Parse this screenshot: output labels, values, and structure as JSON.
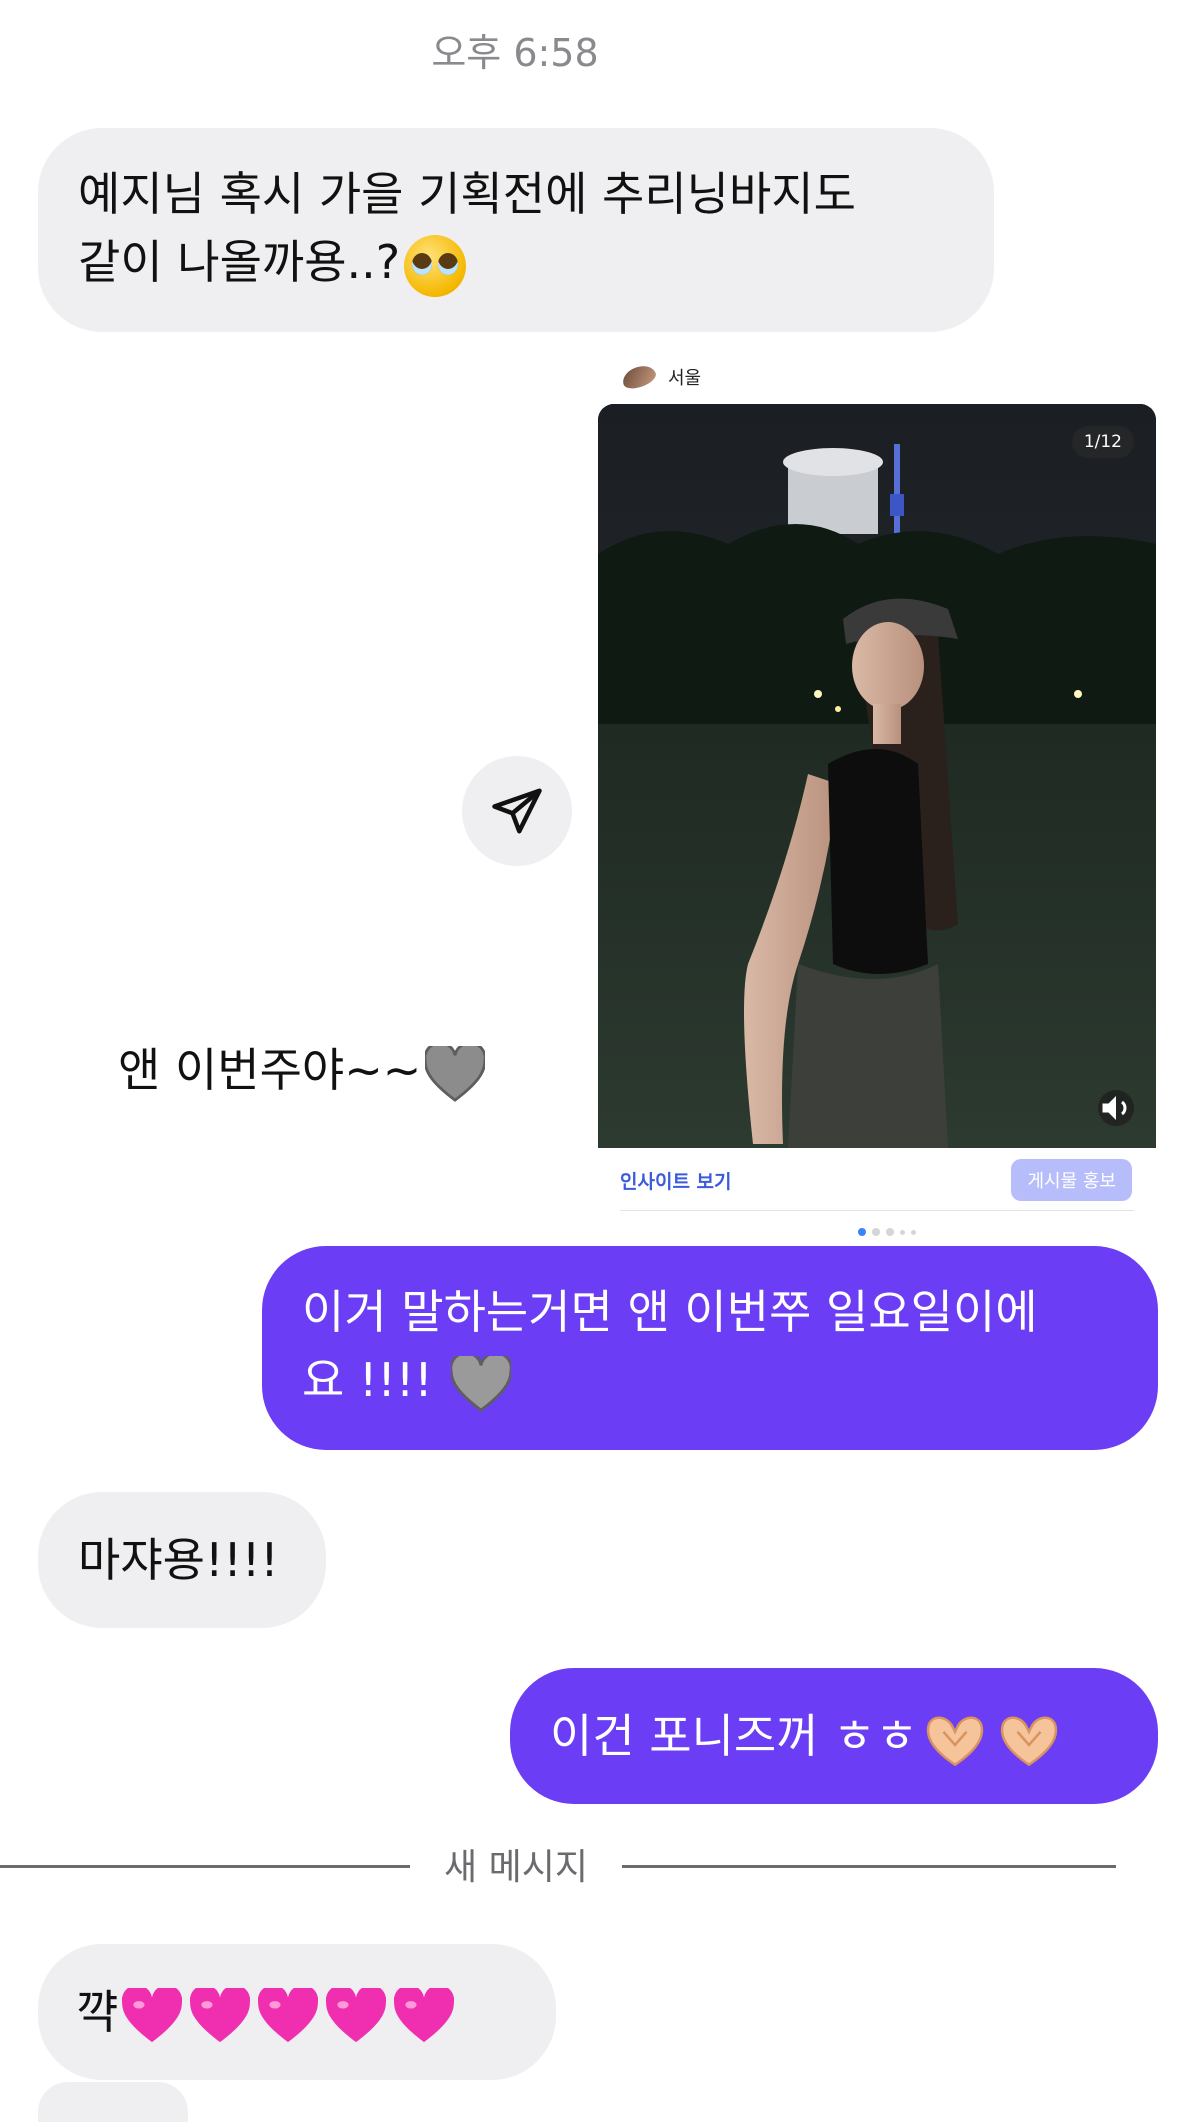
{
  "conversation": {
    "timestamp": "오후 6:58",
    "messages": [
      {
        "direction": "incoming",
        "text": "예지님 혹시 가을 기획전에 추리닝바지도\n같이 나올까용..?",
        "emoji": "pleading-face"
      },
      {
        "direction": "outgoing",
        "type": "shared_post"
      },
      {
        "direction": "outgoing",
        "text": "이거 말하는거면 앤 이번쭈 일요일이에\n요 !!!! ",
        "emoji": "grey-heart"
      },
      {
        "direction": "incoming",
        "text": "마쟈용!!!!"
      },
      {
        "direction": "outgoing",
        "text": "이건 포니즈꺼 ㅎㅎ",
        "emoji": "heart-hands x2"
      },
      {
        "direction": "incoming",
        "text": "꺅",
        "emoji": "pink-heart x5"
      }
    ],
    "new_messages_label": "새 메시지"
  },
  "shared_post": {
    "location": "서울",
    "page_indicator": "1/12",
    "insights_label": "인사이트 보기",
    "promote_label": "게시물 홍보",
    "caption": "앤 이번주야~~",
    "caption_emoji": "grey-heart",
    "carousel_dots": 5,
    "active_dot": 1
  },
  "icons": {
    "share": "paper-plane-icon",
    "volume": "volume-icon"
  },
  "colors": {
    "outgoing_bubble": "#6b3df5",
    "incoming_bubble": "#efeff1",
    "timestamp": "#8a8a8e",
    "insights_link": "#3b5bdb",
    "promote_button": "#b7bdfb"
  }
}
